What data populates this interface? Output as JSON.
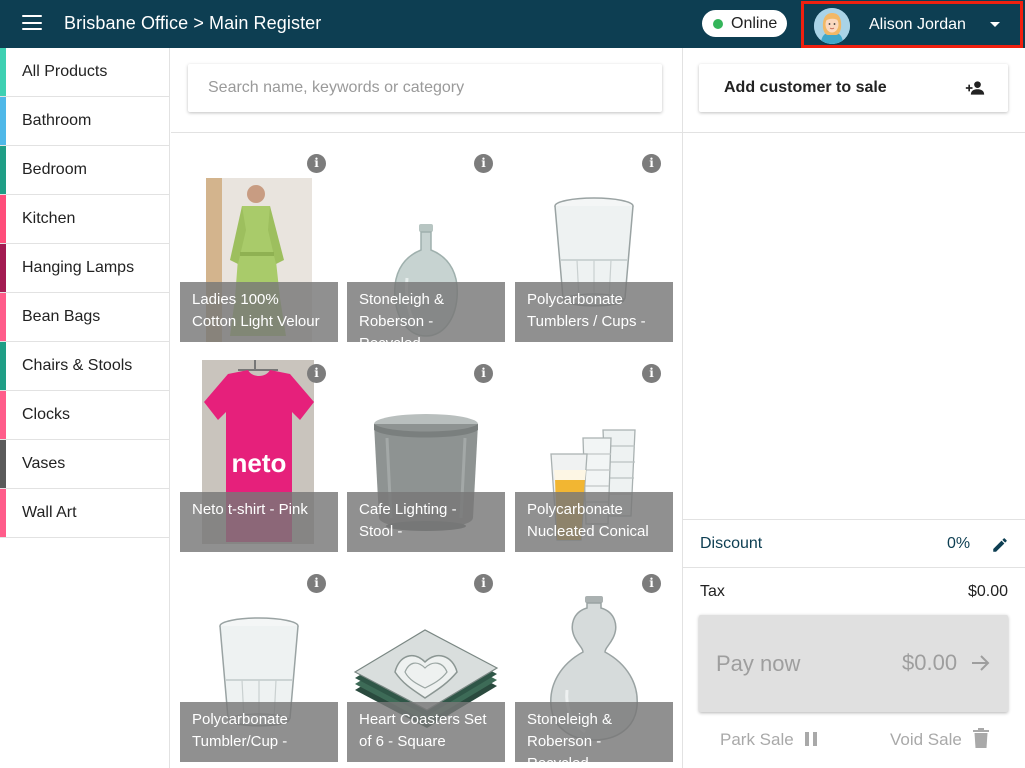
{
  "header": {
    "breadcrumb": "Brisbane Office > Main Register",
    "status": {
      "label": "Online",
      "dot_color": "#34b55a"
    },
    "user": {
      "name": "Alison Jordan"
    }
  },
  "sidebar": {
    "categories": [
      {
        "label": "All Products",
        "color": "#3ed0b2"
      },
      {
        "label": "Bathroom",
        "color": "#4fb8e8"
      },
      {
        "label": "Bedroom",
        "color": "#1f9e86"
      },
      {
        "label": "Kitchen",
        "color": "#ff4d7a"
      },
      {
        "label": "Hanging Lamps",
        "color": "#a31b52"
      },
      {
        "label": "Bean Bags",
        "color": "#ff5c8a"
      },
      {
        "label": "Chairs & Stools",
        "color": "#1f9e86"
      },
      {
        "label": "Clocks",
        "color": "#ff5c8a"
      },
      {
        "label": "Vases",
        "color": "#5a5a5a"
      },
      {
        "label": "Wall Art",
        "color": "#ff5c8a"
      }
    ]
  },
  "search": {
    "placeholder": "Search name, keywords or category"
  },
  "products": [
    {
      "name": "Ladies 100% Cotton Light Velour",
      "icon": "robe-image"
    },
    {
      "name": "Stoneleigh & Roberson - Recycled",
      "icon": "vase-image"
    },
    {
      "name": "Polycarbonate Tumblers / Cups -",
      "icon": "tumbler-image"
    },
    {
      "name": "Neto t-shirt - Pink",
      "icon": "tshirt-image",
      "logo_text": "neto"
    },
    {
      "name": "Cafe Lighting - Stool -",
      "icon": "stool-image"
    },
    {
      "name": "Polycarbonate Nucleated Conical",
      "icon": "conical-glasses-image"
    },
    {
      "name": "Polycarbonate Tumbler/Cup -",
      "icon": "tumbler-image"
    },
    {
      "name": "Heart Coasters Set of 6 - Square",
      "icon": "coasters-image"
    },
    {
      "name": "Stoneleigh & Roberson - Recycled",
      "icon": "gourd-vase-image"
    }
  ],
  "cart": {
    "add_customer_label": "Add customer to sale",
    "discount_label": "Discount",
    "discount_value": "0%",
    "tax_label": "Tax",
    "tax_value": "$0.00",
    "pay_label": "Pay now",
    "pay_amount": "$0.00",
    "park_label": "Park Sale",
    "void_label": "Void Sale"
  }
}
